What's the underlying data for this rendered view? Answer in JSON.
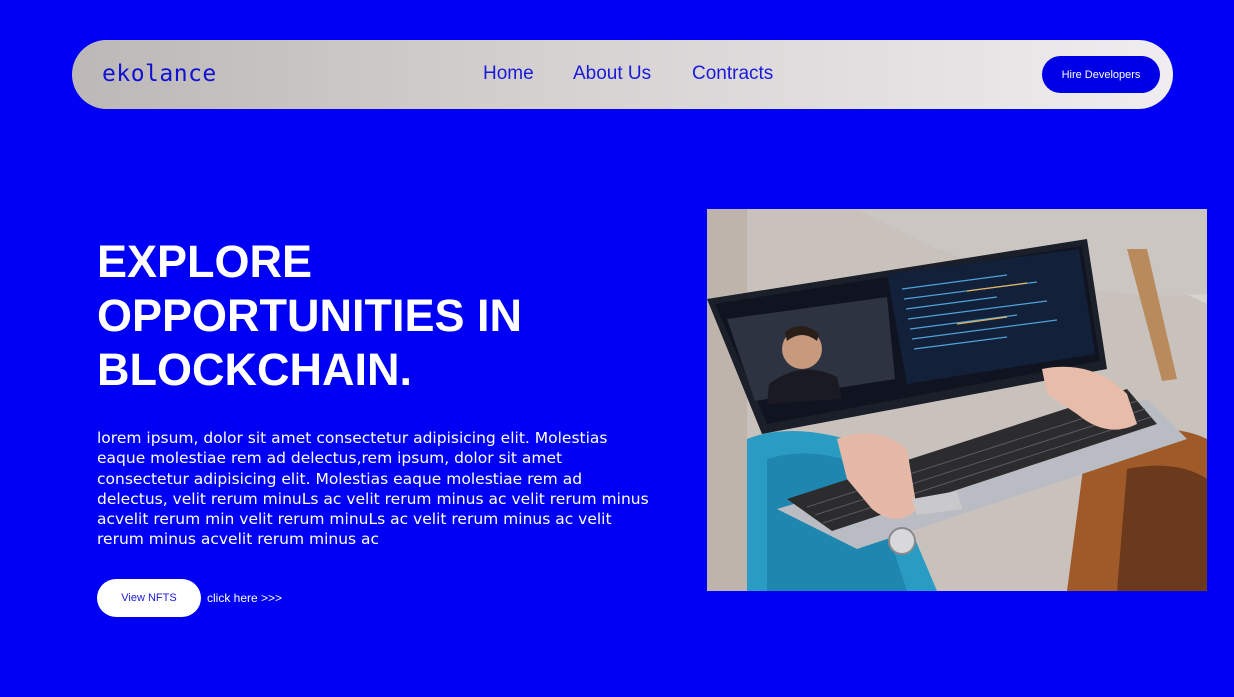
{
  "header": {
    "brand": "ekolance",
    "nav": [
      {
        "label": "Home"
      },
      {
        "label": "About Us"
      },
      {
        "label": "Contracts"
      }
    ],
    "cta_label": "Hire Developers"
  },
  "hero": {
    "title_lines": [
      "EXPLORE",
      "OPPORTUNITIES IN",
      "BLOCKCHAIN."
    ],
    "description": "lorem ipsum, dolor sit amet consectetur adipisicing elit. Molestias eaque molestiae rem ad delectus,rem ipsum, dolor sit amet consectetur adipisicing elit. Molestias eaque molestiae rem ad delectus, velit rerum minuLs ac velit rerum minus ac velit rerum minus acvelit rerum min velit rerum minuLs ac velit rerum minus ac velit rerum minus acvelit rerum minus ac",
    "primary_button": "View NFTS",
    "secondary_link": "click here >>>"
  },
  "colors": {
    "background": "#0000f5",
    "accent": "#0000e6",
    "link": "#1a1ad8"
  },
  "image": {
    "subject": "person-typing-on-laptop-photo"
  }
}
